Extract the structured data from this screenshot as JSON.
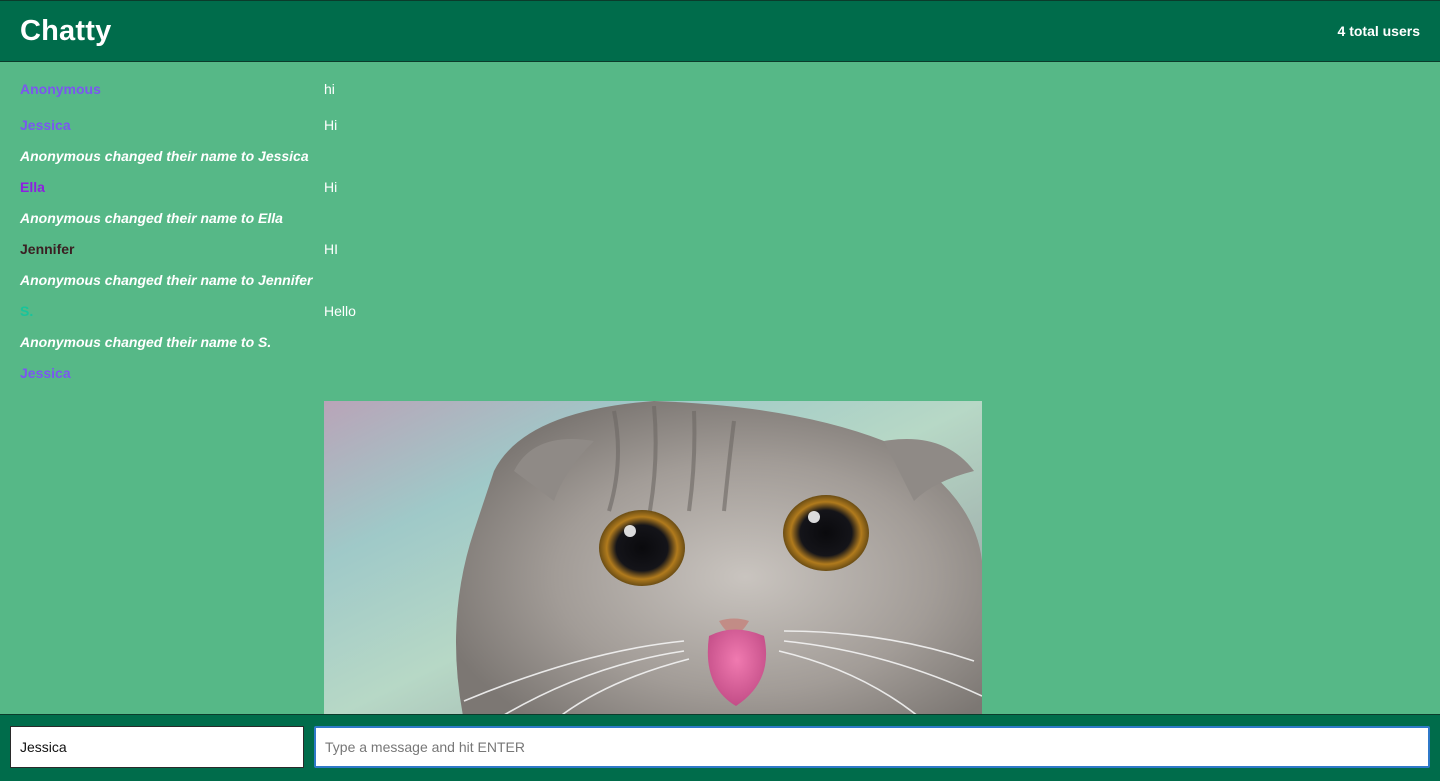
{
  "navbar": {
    "brand": "Chatty",
    "user_count": "4 total users"
  },
  "colors": {
    "navbar": "#006c4b",
    "background": "#56b887",
    "anonymous": "#7b57f0",
    "jessica": "#7b57f0",
    "ella": "#8e1fe0",
    "jennifer": "#3a1f22",
    "s": "#18c49b"
  },
  "messages": [
    {
      "type": "message",
      "username": "Anonymous",
      "content": "hi"
    },
    {
      "type": "message",
      "username": "Jessica",
      "content": "Hi"
    },
    {
      "type": "notification",
      "content": "Anonymous changed their name to Jessica"
    },
    {
      "type": "message",
      "username": "Ella",
      "content": "Hi"
    },
    {
      "type": "notification",
      "content": "Anonymous changed their name to Ella"
    },
    {
      "type": "message",
      "username": "Jennifer",
      "content": "HI"
    },
    {
      "type": "notification",
      "content": "Anonymous changed their name to Jennifer"
    },
    {
      "type": "message",
      "username": "S.",
      "content": "Hello"
    },
    {
      "type": "notification",
      "content": "Anonymous changed their name to S."
    },
    {
      "type": "message",
      "username": "Jessica",
      "content": "cat-image"
    }
  ],
  "chatbar": {
    "username_value": "Jessica",
    "message_placeholder": "Type a message and hit ENTER"
  }
}
